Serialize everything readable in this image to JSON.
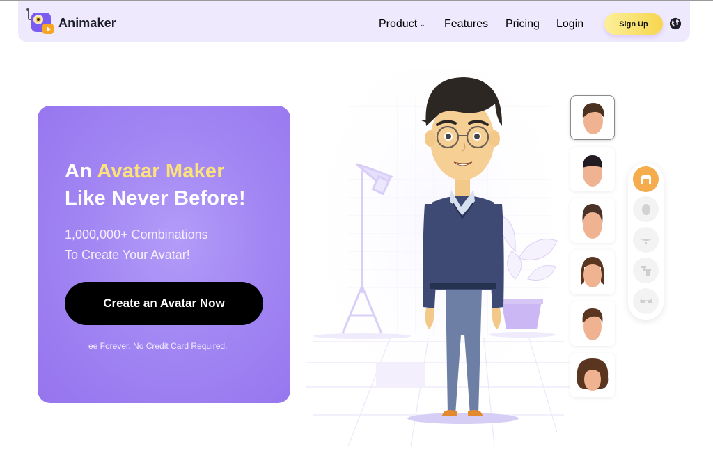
{
  "header": {
    "brand": "Animaker",
    "nav": [
      {
        "label": "Product",
        "has_dropdown": true
      },
      {
        "label": "Features"
      },
      {
        "label": "Pricing"
      },
      {
        "label": "Login"
      }
    ],
    "signup_label": "Sign Up",
    "language_icon": "globe-icon"
  },
  "hero": {
    "title_prefix": "An ",
    "title_highlight": "Avatar Maker",
    "title_line2": "Like Never Before!",
    "subtitle_line1": "1,000,000+ Combinations",
    "subtitle_line2": "To Create Your Avatar!",
    "cta_label": "Create an Avatar Now",
    "note": "ee Forever. No Credit Card Required."
  },
  "avatar_editor": {
    "hair_options": [
      {
        "name": "messy-fringe",
        "selected": true
      },
      {
        "name": "short-crop",
        "selected": false
      },
      {
        "name": "quiff",
        "selected": false
      },
      {
        "name": "mullet",
        "selected": false
      },
      {
        "name": "side-part",
        "selected": false
      },
      {
        "name": "curly",
        "selected": false
      }
    ],
    "categories": [
      {
        "name": "hair",
        "icon": "hair-icon",
        "active": true
      },
      {
        "name": "face",
        "icon": "face-icon",
        "active": false
      },
      {
        "name": "facial-hair",
        "icon": "mustache-icon",
        "active": false
      },
      {
        "name": "outfit",
        "icon": "outfit-icon",
        "active": false
      },
      {
        "name": "glasses",
        "icon": "glasses-icon",
        "active": false
      }
    ]
  },
  "colors": {
    "accent_purple": "#9d82f2",
    "highlight_yellow": "#fbe27a",
    "signup_yellow": "#f7d64e",
    "active_category": "#f4ac4d",
    "navbar_bg": "#efe9fd"
  }
}
